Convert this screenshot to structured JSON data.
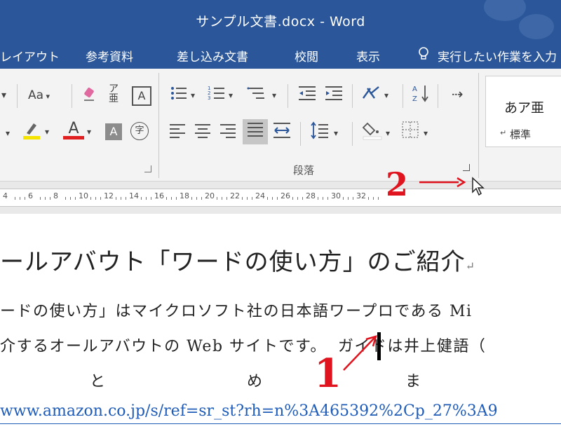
{
  "window": {
    "title": "サンプル文書.docx - Word"
  },
  "tabs": [
    {
      "label": "レイアウト"
    },
    {
      "label": "参考資料"
    },
    {
      "label": "差し込み文書"
    },
    {
      "label": "校閲"
    },
    {
      "label": "表示"
    }
  ],
  "tell_me": {
    "label": "実行したい作業を入力"
  },
  "ribbon": {
    "font_group": {
      "change_case": "Aa",
      "phonetic_guide": "亜",
      "enclosed_character": "字"
    },
    "paragraph_group": {
      "label": "段落"
    },
    "styles": {
      "sample": "あア亜",
      "name": "標準"
    }
  },
  "ruler": {
    "numbers": [
      "4",
      "6",
      "8",
      "10",
      "12",
      "14",
      "16",
      "18",
      "20",
      "22",
      "24",
      "26",
      "28",
      "30",
      "32"
    ]
  },
  "document": {
    "heading": "ールアバウト「ワードの使い方」のご紹介",
    "line1": "ードの使い方」はマイクロソフト社の日本語ワープロである Mi",
    "line2_before": "介するオールアバウトの Web サイトです。",
    "line2_after": "ガイドは井上健語（",
    "spaced_chars": [
      "と",
      "め",
      "ま"
    ],
    "link": "www.amazon.co.jp/s/ref=sr_st?rh=n%3A465392%2Cp_27%3A9"
  },
  "annotations": {
    "step1": "1",
    "step2": "2"
  },
  "colors": {
    "word_blue": "#2b579a",
    "annotation_red": "#e0141e",
    "link_blue": "#1f5cb8"
  }
}
